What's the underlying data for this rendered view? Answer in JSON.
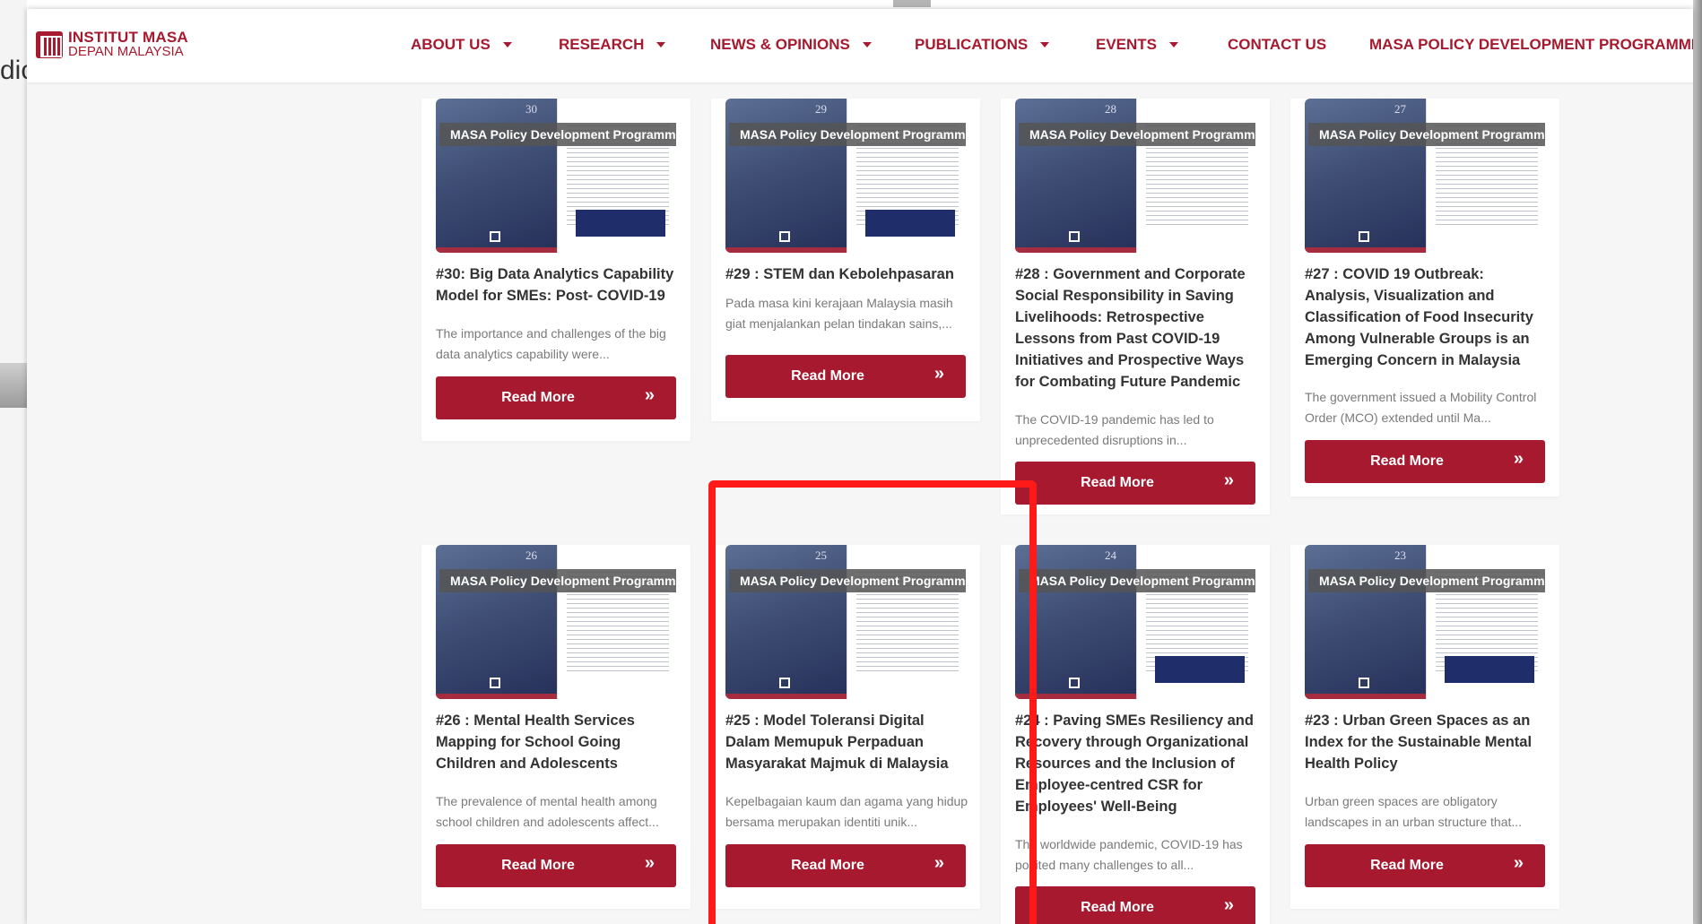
{
  "background": {
    "left_text": "dic"
  },
  "logo": {
    "line1": "INSTITUT MASA",
    "line2": "DEPAN MALAYSIA"
  },
  "nav": [
    {
      "label": "ABOUT US",
      "dropdown": true
    },
    {
      "label": "RESEARCH",
      "dropdown": true
    },
    {
      "label": "NEWS & OPINIONS",
      "dropdown": true
    },
    {
      "label": "PUBLICATIONS",
      "dropdown": true
    },
    {
      "label": "EVENTS",
      "dropdown": true
    },
    {
      "label": "CONTACT US",
      "dropdown": false
    },
    {
      "label": "MASA POLICY DEVELOPMENT PROGRAMME",
      "dropdown": false
    }
  ],
  "badge": "MASA Policy Development Programme",
  "button_label": "Read More",
  "button_icon": "»",
  "colors": {
    "brand": "#a6192e",
    "highlight": "#ff1a1a"
  },
  "cards": [
    {
      "number": "30",
      "title": "#30: Big Data Analytics Capability Model for SMEs: Post- COVID-19",
      "excerpt": "The importance and challenges of the big data analytics capability were..."
    },
    {
      "number": "29",
      "title": "#29 : STEM dan Kebolehpasaran",
      "excerpt": "Pada masa kini kerajaan Malaysia masih giat menjalankan pelan tindakan sains,..."
    },
    {
      "number": "28",
      "title": "#28 : Government and Corporate Social Responsibility in Saving Livelihoods: Retrospective Lessons from Past COVID-19 Initiatives and Prospective Ways for Combating Future Pandemic",
      "excerpt": "The COVID-19 pandemic has led to unprecedented disruptions in..."
    },
    {
      "number": "27",
      "title": "#27 : COVID 19 Outbreak: Analysis, Visualization and Classification of Food Insecurity Among Vulnerable Groups is an Emerging Concern in Malaysia",
      "excerpt": "The government issued a Mobility Control Order (MCO) extended until Ma..."
    },
    {
      "number": "26",
      "title": "#26 : Mental Health Services Mapping for School Going Children and Adolescents",
      "excerpt": "The prevalence of mental health among school children and adolescents affect..."
    },
    {
      "number": "25",
      "title": "#25 : Model Toleransi Digital Dalam Memupuk Perpaduan Masyarakat Majmuk di Malaysia",
      "excerpt": "Kepelbagaian kaum dan agama yang hidup bersama merupakan identiti unik..."
    },
    {
      "number": "24",
      "title": "#24 : Paving SMEs Resiliency and Recovery through Organizational Resources and the Inclusion of Employee-centred CSR for Employees' Well-Being",
      "excerpt": "The worldwide pandemic, COVID-19 has posited many challenges to all..."
    },
    {
      "number": "23",
      "title": "#23 : Urban Green Spaces as an Index for the Sustainable Mental Health Policy",
      "excerpt": "Urban green spaces are obligatory landscapes in an urban structure that..."
    }
  ]
}
